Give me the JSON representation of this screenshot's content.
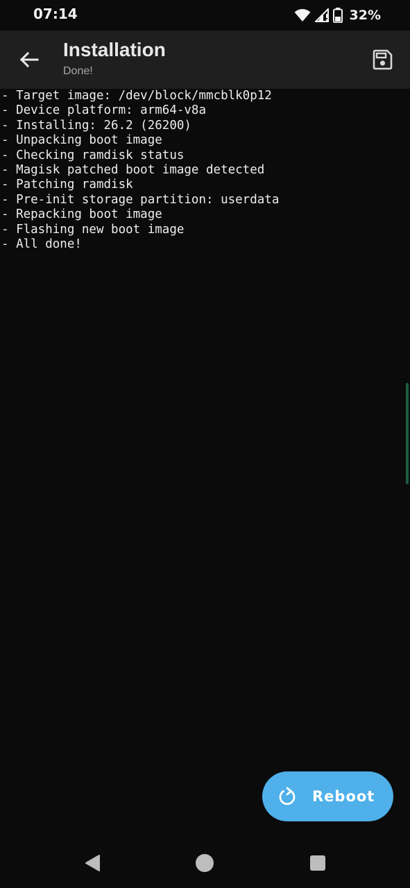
{
  "status_bar": {
    "time": "07:14",
    "battery": "32%",
    "icons": [
      "wifi-icon",
      "cell-signal-icon",
      "battery-icon"
    ]
  },
  "app_bar": {
    "title": "Installation",
    "subtitle": "Done!",
    "back_icon": "arrow-back-icon",
    "save_icon": "save-icon"
  },
  "log": {
    "lines": [
      "- Target image: /dev/block/mmcblk0p12",
      "- Device platform: arm64-v8a",
      "- Installing: 26.2 (26200)",
      "- Unpacking boot image",
      "- Checking ramdisk status",
      "- Magisk patched boot image detected",
      "- Patching ramdisk",
      "- Pre-init storage partition: userdata",
      "- Repacking boot image",
      "- Flashing new boot image",
      "- All done!"
    ]
  },
  "fab": {
    "label": "Reboot",
    "icon": "restart-icon",
    "color": "#4fb0ea"
  },
  "nav_bar": {
    "icons": [
      "nav-back-icon",
      "nav-home-icon",
      "nav-recents-icon"
    ]
  },
  "colors": {
    "background": "#0b0b0b",
    "app_bar": "#1f1f1f",
    "accent": "#4fb0ea"
  }
}
